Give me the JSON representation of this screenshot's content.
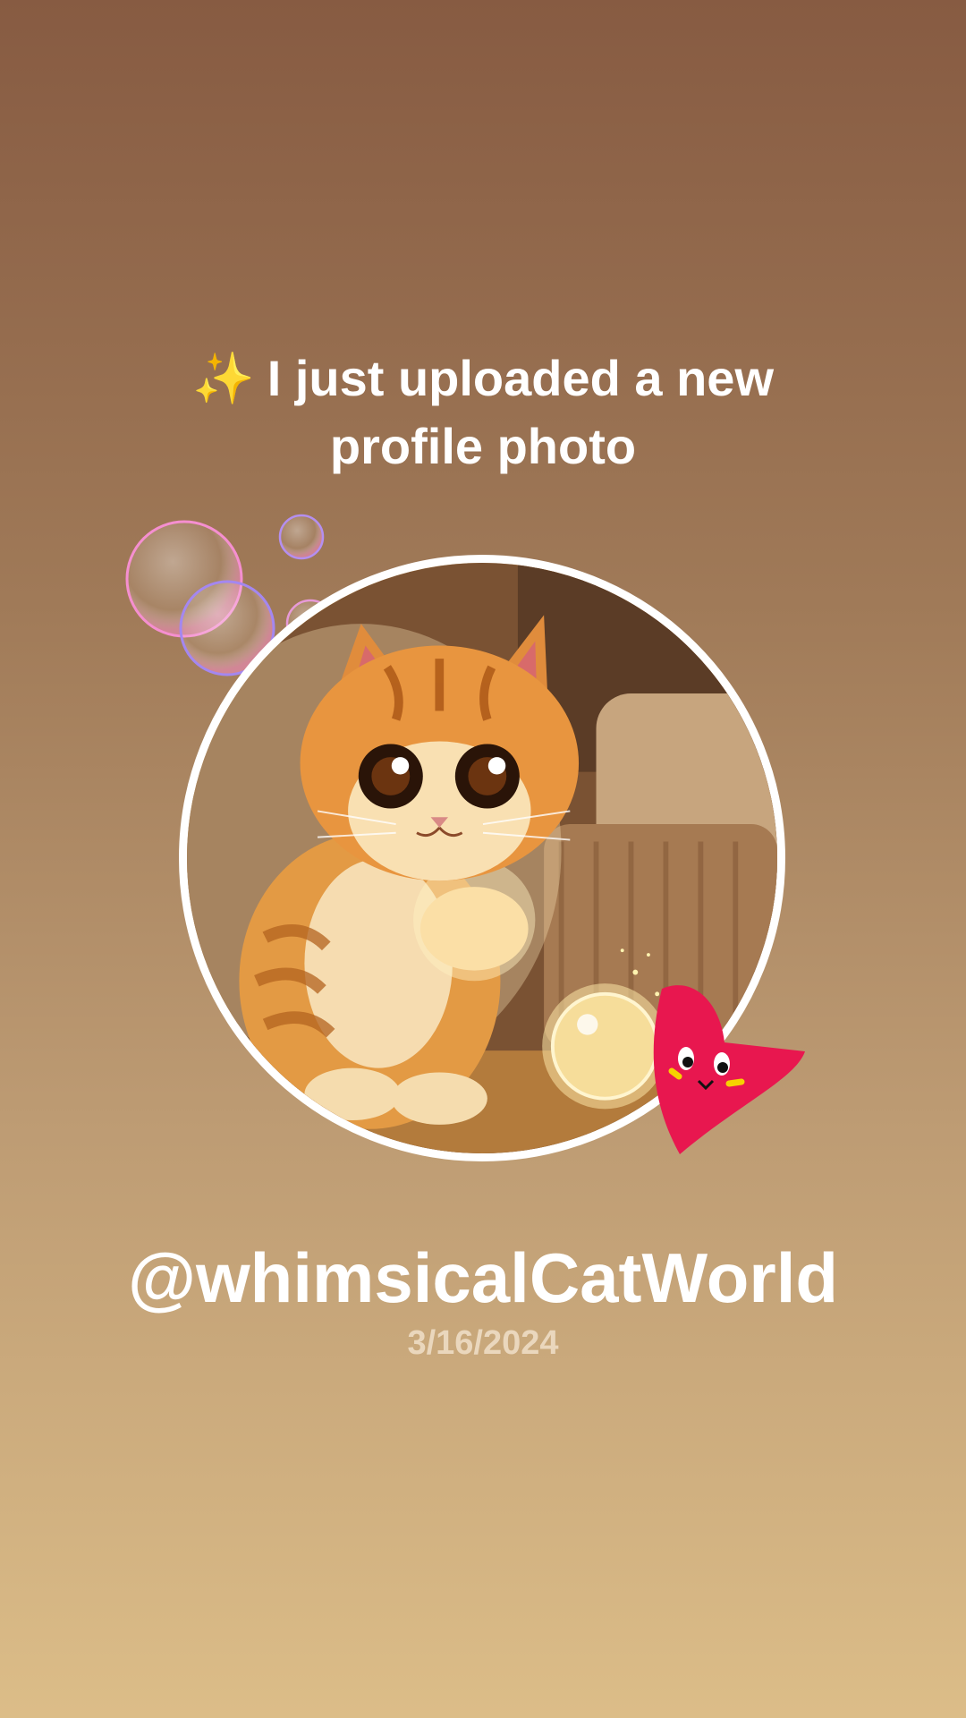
{
  "post": {
    "sparkle_icon": "✨",
    "headline_line1": "I just uploaded a new",
    "headline_line2": "profile photo",
    "username": "@whimsicalCatWorld",
    "date": "3/16/2024"
  },
  "icons": {
    "sparkle": "sparkle-icon",
    "heart": "heart-sticker-icon",
    "bubbles": "bubbles-sticker-icon"
  },
  "colors": {
    "background_top": "#875b42",
    "background_bottom": "#dcbd88",
    "text": "#ffffff",
    "date_text": "#ead7bd",
    "heart": "#e8174f",
    "sparkle": "#f3c844"
  }
}
